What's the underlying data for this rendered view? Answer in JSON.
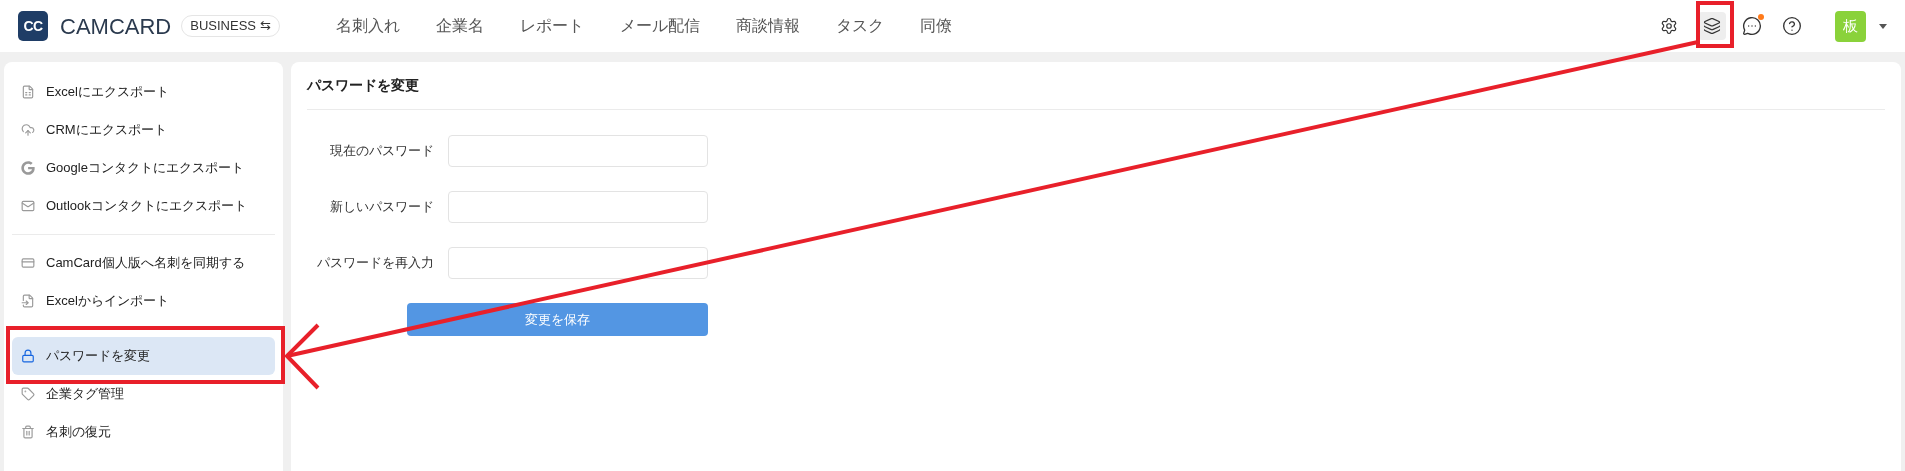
{
  "header": {
    "logo_text": "CC",
    "brand": "CAMCARD",
    "edition_badge": "BUSINESS ⇆",
    "nav": [
      {
        "label": "名刺入れ",
        "selected": false
      },
      {
        "label": "企業名",
        "selected": false
      },
      {
        "label": "レポート",
        "selected": false
      },
      {
        "label": "メール配信",
        "selected": false
      },
      {
        "label": "商談情報",
        "selected": false
      },
      {
        "label": "タスク",
        "selected": false
      },
      {
        "label": "同僚",
        "selected": false
      }
    ],
    "messages_unread": true,
    "avatar": "板"
  },
  "sidebar": {
    "groups": [
      {
        "items": [
          {
            "label": "Excelにエクスポート",
            "selected": false
          },
          {
            "label": "CRMにエクスポート",
            "selected": false
          },
          {
            "label": "Googleコンタクトにエクスポート",
            "selected": false
          },
          {
            "label": "Outlookコンタクトにエクスポート",
            "selected": false
          }
        ]
      },
      {
        "items": [
          {
            "label": "CamCard個人版へ名刺を同期する",
            "selected": false
          },
          {
            "label": "Excelからインポート",
            "selected": false
          },
          {
            "label": "パスワードを変更",
            "selected": true
          },
          {
            "label": "企業タグ管理",
            "selected": false
          },
          {
            "label": "名刺の復元",
            "selected": false
          }
        ]
      }
    ]
  },
  "panel": {
    "title": "パスワードを変更",
    "fields": [
      {
        "label": "現在のパスワード"
      },
      {
        "label": "新しいパスワード"
      },
      {
        "label": "パスワードを再入力"
      }
    ],
    "submit": "変更を保存"
  }
}
